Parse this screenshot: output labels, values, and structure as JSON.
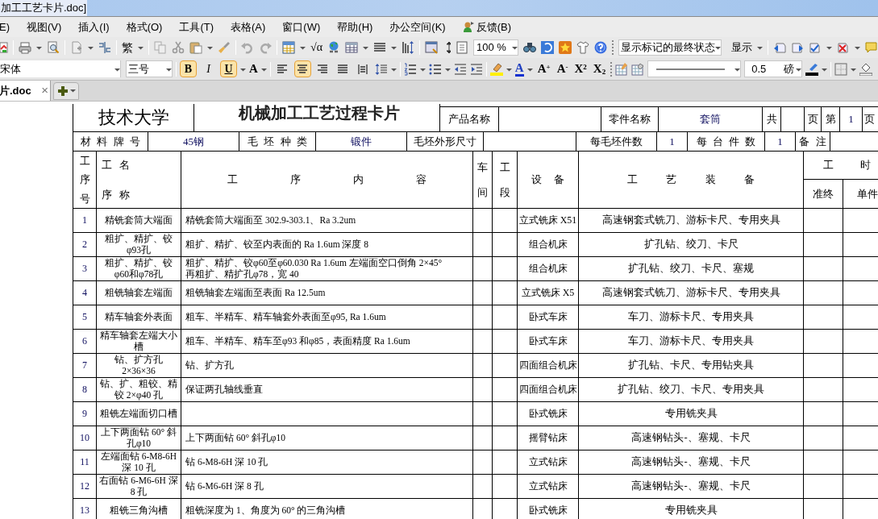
{
  "window": {
    "title": "加工工艺卡片.doc]"
  },
  "menu": [
    {
      "label": "E)",
      "kind": "plain"
    },
    {
      "label": "视图(V)",
      "kind": "plain"
    },
    {
      "label": "插入(I)",
      "kind": "plain"
    },
    {
      "label": "格式(O)",
      "kind": "plain"
    },
    {
      "label": "工具(T)",
      "kind": "plain"
    },
    {
      "label": "表格(A)",
      "kind": "plain"
    },
    {
      "label": "窗口(W)",
      "kind": "plain"
    },
    {
      "label": "帮助(H)",
      "kind": "plain"
    },
    {
      "label": "办公空间(K)",
      "kind": "plain"
    },
    {
      "label": "反馈(B)",
      "kind": "feedback"
    }
  ],
  "toolbar": {
    "script_button": "繁",
    "formula_button": "√α",
    "zoom": "100 %",
    "markup_view": "显示标记的最终状态",
    "show_button": "显示"
  },
  "format_bar": {
    "font": "宋体",
    "size": "三号",
    "styles": [
      {
        "label": "B",
        "selected": true
      },
      {
        "label": "I",
        "selected": false
      },
      {
        "label": "U",
        "selected": true
      }
    ],
    "font_effect": "A",
    "alignment": [
      {
        "kind": "left",
        "selected": false
      },
      {
        "kind": "center",
        "selected": true
      },
      {
        "kind": "right",
        "selected": false
      },
      {
        "kind": "justify",
        "selected": false
      },
      {
        "kind": "distributed",
        "selected": false
      }
    ],
    "font_color": "A",
    "script_buttons": [
      "A$^{+}$",
      "A$^{-}$",
      "X$^{2}$",
      "X$_{2}$"
    ],
    "line_weight": "0.5",
    "weight_unit": "磅"
  },
  "tabs": [
    {
      "label": "片.doc",
      "close": "×",
      "selected": true
    }
  ],
  "document": {
    "school": "技术大学",
    "title": "机械加工工艺过程卡片",
    "info_rows": [
      [
        {
          "kind": "label",
          "text": "产品名称"
        },
        {
          "kind": "blank"
        },
        {
          "kind": "label",
          "text": "零件名称"
        },
        {
          "kind": "value",
          "text": "套筒"
        },
        {
          "kind": "label",
          "text": "共"
        },
        {
          "kind": "blank"
        },
        {
          "kind": "label",
          "text": "页"
        },
        {
          "kind": "label",
          "text": "第"
        },
        {
          "kind": "value",
          "text": "1"
        },
        {
          "kind": "label",
          "text": "页"
        }
      ],
      [
        {
          "kind": "label",
          "text": "材 料 牌 号"
        },
        {
          "kind": "value",
          "text": "45钢"
        },
        {
          "kind": "label",
          "text": "毛 坯 种 类"
        },
        {
          "kind": "value",
          "text": "锻件"
        },
        {
          "kind": "label",
          "text": "毛坯外形尺寸"
        },
        {
          "kind": "blank"
        },
        {
          "kind": "label",
          "text": "每毛坯件数"
        },
        {
          "kind": "value",
          "text": "1"
        },
        {
          "kind": "label",
          "text": "每 台 件 数"
        },
        {
          "kind": "value",
          "text": "1"
        },
        {
          "kind": "label",
          "text": "备 注"
        },
        {
          "kind": "blank"
        }
      ]
    ],
    "columns": {
      "seq_no": "工序号",
      "name_top": "工 名",
      "name_bottom": "序 称",
      "content": "工 序 内 容",
      "workshop": "车间",
      "section": "工段",
      "equipment": "设 备",
      "tooling": "工 艺 装 备",
      "hours": "工 时",
      "prep": "准终",
      "unit": "单件"
    },
    "rows": [
      {
        "no": "1",
        "name": "精铣套筒大端面",
        "content": "精铣套筒大端面至 302.9-303.1、Ra 3.2um",
        "equipment": "立式铣床 X51",
        "tooling": "高速钢套式铣刀、游标卡尺、专用夹具"
      },
      {
        "no": "2",
        "name": "粗扩、精扩、铰\nφ93孔",
        "content": "粗扩、精扩、铰至内表面的 Ra 1.6um  深度 8",
        "equipment": "组合机床",
        "tooling": "扩孔钻、绞刀、卡尺"
      },
      {
        "no": "3",
        "name": "粗扩、精扩、铰\nφ60和φ78孔",
        "content": "粗扩、精扩、铰φ60至φ60.030  Ra 1.6um 左端面空口倒角 2×45°\n 再粗扩、精扩孔φ78，宽 40",
        "equipment": "组合机床",
        "tooling": "扩孔钻、绞刀、卡尺、塞规"
      },
      {
        "no": "4",
        "name": "粗铣轴套左端面",
        "content": "粗铣轴套左端面至表面 Ra 12.5um",
        "equipment": "立式铣床 X5",
        "tooling": "高速钢套式铣刀、游标卡尺、专用夹具"
      },
      {
        "no": "5",
        "name": "精车轴套外表面",
        "content": "粗车、半精车、精车轴套外表面至φ95, Ra 1.6um",
        "equipment": "卧式车床",
        "tooling": "车刀、游标卡尺、专用夹具"
      },
      {
        "no": "6",
        "name": "精车轴套左端大小槽",
        "content": "粗车、半精车、精车至φ93 和φ85，表面精度  Ra 1.6um",
        "equipment": "卧式车床",
        "tooling": "车刀、游标卡尺、专用夹具"
      },
      {
        "no": "7",
        "name": "钻、扩方孔\n2×36×36",
        "content": "钻、扩方孔",
        "equipment": "四面组合机床",
        "tooling": "扩孔钻、卡尺、专用钻夹具"
      },
      {
        "no": "8",
        "name": "钻、扩、粗铰、精铰 2×φ40 孔",
        "content": "保证两孔轴线垂直",
        "equipment": "四面组合机床",
        "tooling": "扩孔钻、绞刀、卡尺、专用夹具"
      },
      {
        "no": "9",
        "name": "粗铣左端面切口槽",
        "equipment": "卧式铣床",
        "tooling": "专用铣夹具"
      },
      {
        "no": "10",
        "name": "上下两面钻 60° 斜孔φ10",
        "content": "上下两面钻 60° 斜孔φ10",
        "equipment": "摇臂钻床",
        "tooling": "高速钢钻头-、塞规、卡尺"
      },
      {
        "no": "11",
        "name": "左端面钻 6-M8-6H\n深 10 孔",
        "content": "钻 6-M8-6H 深 10 孔",
        "equipment": "立式钻床",
        "tooling": "高速钢钻头-、塞规、卡尺"
      },
      {
        "no": "12",
        "name": "右面钻 6-M6-6H 深\n8 孔",
        "content": "钻 6-M6-6H 深 8 孔",
        "equipment": "立式钻床",
        "tooling": "高速钢钻头-、塞规、卡尺"
      },
      {
        "no": "13",
        "name": "粗铣三角沟槽",
        "content": "粗铣深度为 1、角度为 60° 的三角沟槽",
        "equipment": "卧式铣床",
        "tooling": "专用铣夹具"
      }
    ]
  }
}
